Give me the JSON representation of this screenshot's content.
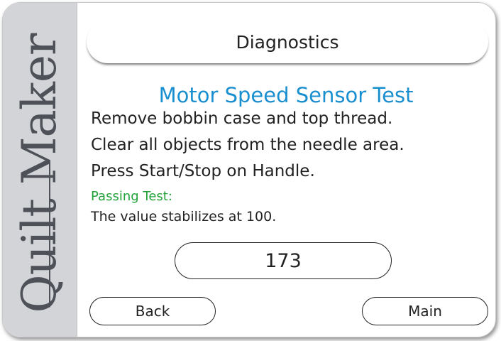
{
  "brand": {
    "name": "Quilt Maker"
  },
  "header": {
    "title": "Diagnostics"
  },
  "test": {
    "title": "Motor Speed Sensor Test",
    "instructions": [
      "Remove bobbin case and top thread.",
      "Clear all objects from the needle area.",
      "Press Start/Stop on Handle."
    ],
    "passing_label": "Passing Test:",
    "passing_description": "The value stabilizes at 100.",
    "value": "173"
  },
  "buttons": {
    "back_label": "Back",
    "main_label": "Main"
  },
  "colors": {
    "accent": "#1a8fd0",
    "pass": "#23a23a",
    "sidebar": "#d3d4d8",
    "brand_text": "#4f5159"
  }
}
